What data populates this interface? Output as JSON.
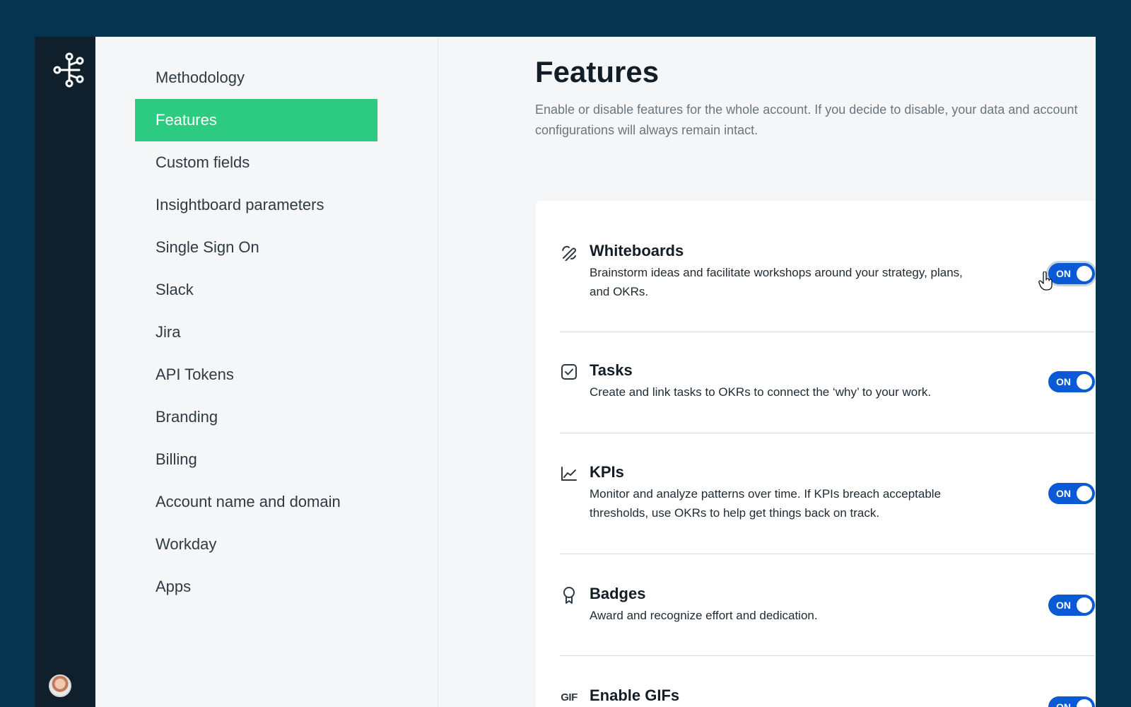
{
  "nav": {
    "items": [
      {
        "label": "Methodology",
        "active": false
      },
      {
        "label": "Features",
        "active": true
      },
      {
        "label": "Custom fields",
        "active": false
      },
      {
        "label": "Insightboard parameters",
        "active": false
      },
      {
        "label": "Single Sign On",
        "active": false
      },
      {
        "label": "Slack",
        "active": false
      },
      {
        "label": "Jira",
        "active": false
      },
      {
        "label": "API Tokens",
        "active": false
      },
      {
        "label": "Branding",
        "active": false
      },
      {
        "label": "Billing",
        "active": false
      },
      {
        "label": "Account name and domain",
        "active": false
      },
      {
        "label": "Workday",
        "active": false
      },
      {
        "label": "Apps",
        "active": false
      }
    ]
  },
  "page": {
    "title": "Features",
    "description": "Enable or disable features for the whole account. If you decide to disable, your data and account configurations will always remain intact."
  },
  "features": [
    {
      "icon": "whiteboard-icon",
      "title": "Whiteboards",
      "description": "Brainstorm ideas and facilitate workshops around your strategy, plans, and OKRs.",
      "toggle": "ON",
      "enabled": true
    },
    {
      "icon": "task-checkbox-icon",
      "title": "Tasks",
      "description": "Create and link tasks to OKRs to connect the ‘why’ to your work.",
      "toggle": "ON",
      "enabled": true
    },
    {
      "icon": "chart-line-icon",
      "title": "KPIs",
      "description": "Monitor and analyze patterns over time. If KPIs breach acceptable thresholds, use OKRs to help get things back on track.",
      "toggle": "ON",
      "enabled": true
    },
    {
      "icon": "badge-icon",
      "title": "Badges",
      "description": "Award and recognize effort and dedication.",
      "toggle": "ON",
      "enabled": true
    },
    {
      "icon": "gif-icon",
      "icon_text": "GIF",
      "title": "Enable GIFs",
      "description": "",
      "toggle": "ON",
      "enabled": true
    }
  ],
  "colors": {
    "background": "#05344f",
    "rail": "#0f1f2b",
    "accent_active": "#2dcb82",
    "toggle_on": "#0a5ad6"
  }
}
